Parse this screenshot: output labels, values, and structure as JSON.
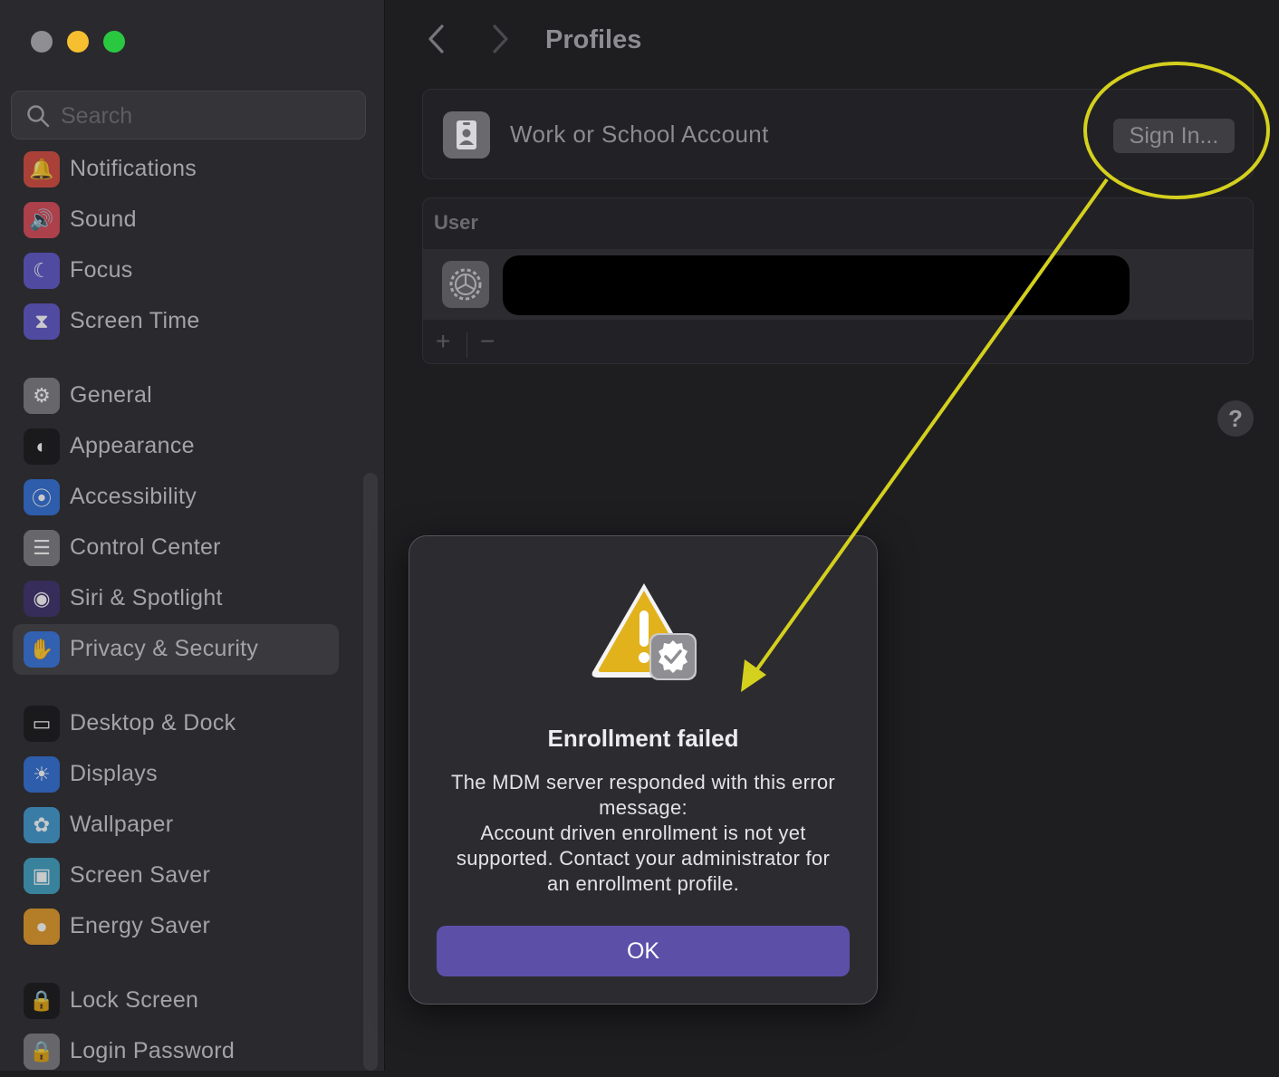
{
  "window": {
    "traffic_lights": [
      {
        "name": "close",
        "color": "#8f8e92"
      },
      {
        "name": "minimize",
        "color": "#f5bf2f"
      },
      {
        "name": "zoom",
        "color": "#2ac840"
      }
    ]
  },
  "sidebar": {
    "search_placeholder": "Search",
    "items": [
      {
        "label": "Notifications",
        "icon": "bell-icon",
        "color": "#d44a3d"
      },
      {
        "label": "Sound",
        "icon": "speaker-icon",
        "color": "#d84855"
      },
      {
        "label": "Focus",
        "icon": "moon-icon",
        "color": "#5d55c8"
      },
      {
        "label": "Screen Time",
        "icon": "hourglass-icon",
        "color": "#5d55c8"
      },
      {
        "label": "General",
        "icon": "gear-icon",
        "color": "#7c7b80"
      },
      {
        "label": "Appearance",
        "icon": "appearance-icon",
        "color": "#151517"
      },
      {
        "label": "Accessibility",
        "icon": "accessibility-icon",
        "color": "#2f6fd6"
      },
      {
        "label": "Control Center",
        "icon": "toggles-icon",
        "color": "#7c7b80"
      },
      {
        "label": "Siri & Spotlight",
        "icon": "siri-icon",
        "color": "#3b2f6a"
      },
      {
        "label": "Privacy & Security",
        "icon": "hand-icon",
        "color": "#2f6fd6"
      },
      {
        "label": "Desktop & Dock",
        "icon": "dock-icon",
        "color": "#151517"
      },
      {
        "label": "Displays",
        "icon": "sun-icon",
        "color": "#2f6fd6"
      },
      {
        "label": "Wallpaper",
        "icon": "flower-icon",
        "color": "#3f9ad0"
      },
      {
        "label": "Screen Saver",
        "icon": "screensaver-icon",
        "color": "#3fa0c0"
      },
      {
        "label": "Energy Saver",
        "icon": "bulb-icon",
        "color": "#e39a26"
      },
      {
        "label": "Lock Screen",
        "icon": "lock-icon",
        "color": "#151517"
      },
      {
        "label": "Login Password",
        "icon": "lock-icon",
        "color": "#7c7b80"
      }
    ],
    "selected": "Privacy & Security"
  },
  "header": {
    "back": "‹",
    "forward": "›",
    "title": "Profiles"
  },
  "account_card": {
    "label": "Work or School Account",
    "sign_in_button": "Sign In..."
  },
  "user_section": {
    "header": "User",
    "add": "+",
    "remove": "−"
  },
  "help": "?",
  "dialog": {
    "title": "Enrollment failed",
    "message": "The MDM server responded with this error message:\nAccount driven enrollment is not yet supported. Contact your administrator for an enrollment profile.",
    "ok_button": "OK"
  },
  "annotation": {
    "color": "#d4d01e"
  }
}
